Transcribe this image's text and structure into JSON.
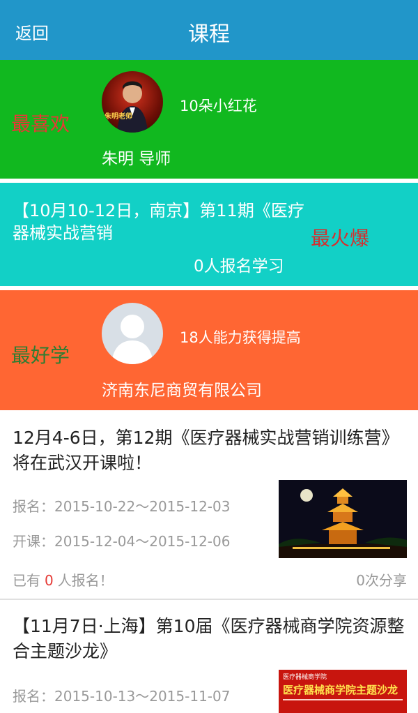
{
  "header": {
    "back_label": "返回",
    "title": "课程"
  },
  "green_card": {
    "tag": "最喜欢",
    "flowers": "10朵小红花",
    "name": "朱明 导师",
    "avatar_text": "朱明老师"
  },
  "teal_card": {
    "title": "【10月10-12日，南京】第11期《医疗器械实战营销",
    "tag": "最火爆",
    "signup": "0人报名学习"
  },
  "orange_card": {
    "tag": "最好学",
    "improved": "18人能力获得提高",
    "company": "济南东尼商贸有限公司"
  },
  "courses": [
    {
      "title": "12月4-6日，第12期《医疗器械实战营销训练营》将在武汉开课啦！",
      "signup_label": "报名：",
      "signup_range": "2015-10-22～2015-12-03",
      "start_label": "开课：",
      "start_range": "2015-12-04～2015-12-06",
      "enrolled_prefix": "已有",
      "enrolled_count": "0",
      "enrolled_suffix": "人报名！",
      "shares": "0次分享"
    },
    {
      "title": "【11月7日·上海】第10届《医疗器械商学院资源整合主题沙龙》",
      "signup_label": "报名：",
      "signup_range": "2015-10-13～2015-11-07",
      "thumb_brand": "医疗器械商学院",
      "thumb_title": "医疗器械商学院主题沙龙"
    }
  ]
}
